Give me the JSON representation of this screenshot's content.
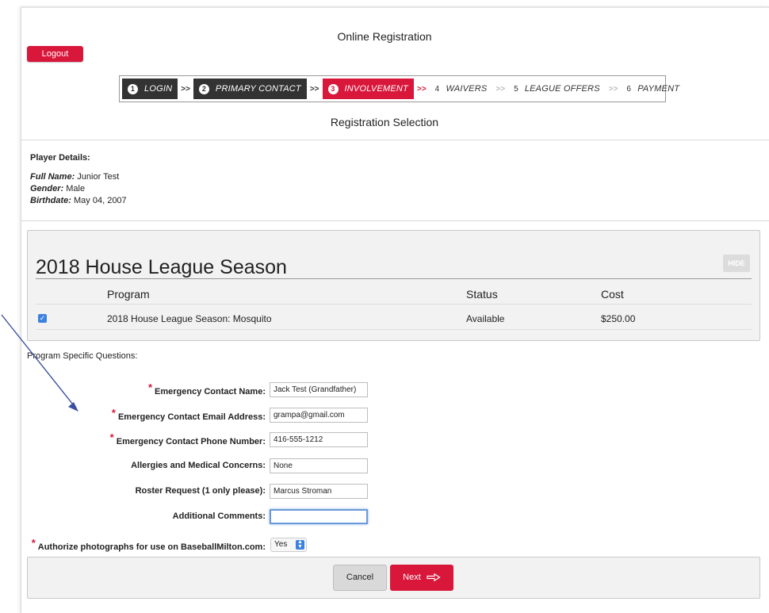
{
  "header": {
    "title": "Online Registration",
    "logout_label": "Logout"
  },
  "steps": [
    {
      "num": "1",
      "label": "LOGIN"
    },
    {
      "num": "2",
      "label": "PRIMARY CONTACT"
    },
    {
      "num": "3",
      "label": "INVOLVEMENT"
    },
    {
      "num": "4",
      "label": "WAIVERS"
    },
    {
      "num": "5",
      "label": "LEAGUE OFFERS"
    },
    {
      "num": "6",
      "label": "PAYMENT"
    }
  ],
  "step_separator": ">>",
  "section_title": "Registration Selection",
  "player": {
    "heading": "Player Details:",
    "full_name_label": "Full Name:",
    "full_name": "Junior Test",
    "gender_label": "Gender:",
    "gender": "Male",
    "birthdate_label": "Birthdate:",
    "birthdate": "May 04, 2007"
  },
  "season": {
    "title": "2018 House League Season",
    "hide_label": "HIDE",
    "columns": {
      "program": "Program",
      "status": "Status",
      "cost": "Cost"
    },
    "rows": [
      {
        "program": "2018 House League Season: Mosquito",
        "status": "Available",
        "cost": "$250.00",
        "checked": true
      }
    ]
  },
  "questions_heading": "Program Specific Questions:",
  "questions": {
    "emergency_name": {
      "label": "Emergency Contact Name:",
      "value": "Jack Test (Grandfather)",
      "required": true
    },
    "emergency_email": {
      "label": "Emergency Contact Email Address:",
      "value": "grampa@gmail.com",
      "required": true
    },
    "emergency_phone": {
      "label": "Emergency Contact Phone Number:",
      "value": "416-555-1212",
      "required": true
    },
    "allergies": {
      "label": "Allergies and Medical Concerns:",
      "value": "None",
      "required": false
    },
    "roster": {
      "label": "Roster Request (1 only please):",
      "value": "Marcus Stroman",
      "required": false
    },
    "comments": {
      "label": "Additional Comments:",
      "value": "",
      "required": false
    },
    "photos": {
      "label": "Authorize photographs for use on BaseballMilton.com:",
      "value": "Yes",
      "required": true
    }
  },
  "required_marker": "*",
  "footer": {
    "cancel_label": "Cancel",
    "next_label": "Next"
  },
  "colors": {
    "brand_red": "#d8173b",
    "dark_step": "#333333",
    "panel_bg": "#f2f2f2",
    "checkbox_blue": "#3b82e0"
  },
  "icons": {
    "next_arrow": "arrow-right-outline-icon",
    "select_arrows": "up-down-chevron-icon",
    "checkbox": "checkmark-icon"
  }
}
